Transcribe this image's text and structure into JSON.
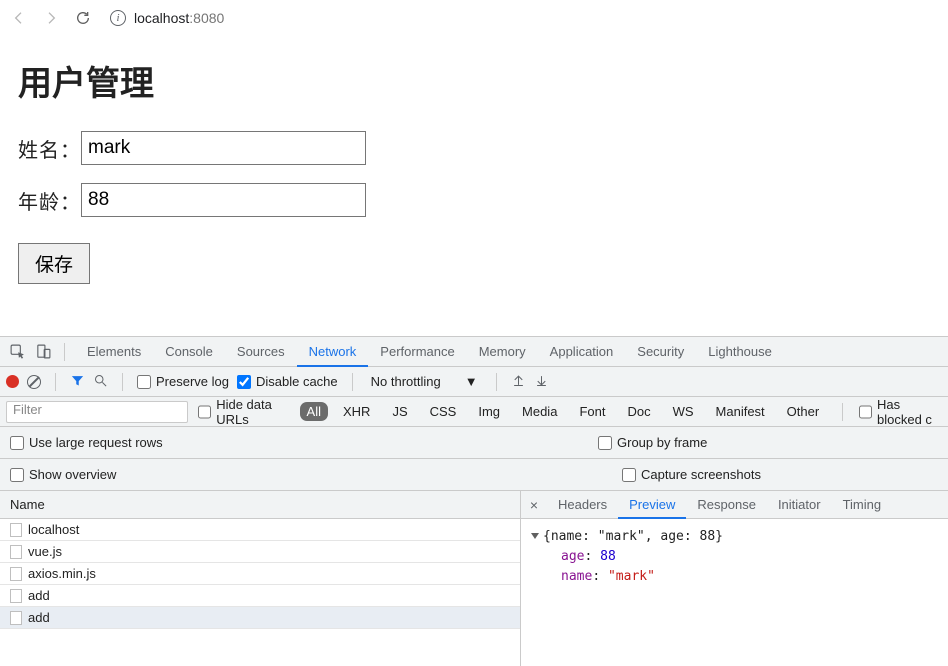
{
  "browser": {
    "url_host": "localhost",
    "url_port": ":8080"
  },
  "page": {
    "title": "用户管理",
    "name_label": "姓名：",
    "name_value": "mark",
    "age_label": "年龄：",
    "age_value": "88",
    "save_label": "保存"
  },
  "devtools": {
    "tabs": [
      "Elements",
      "Console",
      "Sources",
      "Network",
      "Performance",
      "Memory",
      "Application",
      "Security",
      "Lighthouse"
    ],
    "active_tab": "Network",
    "toolbar": {
      "preserve_log": "Preserve log",
      "preserve_log_checked": false,
      "disable_cache": "Disable cache",
      "disable_cache_checked": true,
      "throttling": "No throttling"
    },
    "filter": {
      "placeholder": "Filter",
      "hide_data_urls": "Hide data URLs",
      "types": [
        "All",
        "XHR",
        "JS",
        "CSS",
        "Img",
        "Media",
        "Font",
        "Doc",
        "WS",
        "Manifest",
        "Other"
      ],
      "active_type": "All",
      "has_blocked": "Has blocked c"
    },
    "options": {
      "use_large_rows": "Use large request rows",
      "group_by_frame": "Group by frame",
      "show_overview": "Show overview",
      "capture_screenshots": "Capture screenshots"
    },
    "list": {
      "column": "Name",
      "requests": [
        "localhost",
        "vue.js",
        "axios.min.js",
        "add",
        "add"
      ]
    },
    "detail": {
      "tabs": [
        "Headers",
        "Preview",
        "Response",
        "Initiator",
        "Timing"
      ],
      "active_tab": "Preview",
      "summary": "{name: \"mark\", age: 88}",
      "fields": [
        {
          "k": "age",
          "v": "88",
          "t": "num"
        },
        {
          "k": "name",
          "v": "\"mark\"",
          "t": "str"
        }
      ]
    }
  }
}
